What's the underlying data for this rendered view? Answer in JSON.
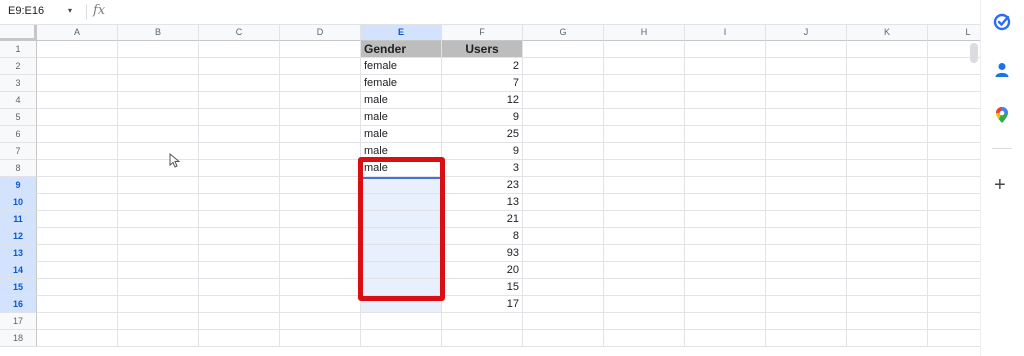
{
  "name_box": {
    "value": "E9:E16",
    "caret": "▾"
  },
  "formula_bar": {
    "fx_label": "fx",
    "value": ""
  },
  "columns": [
    "A",
    "B",
    "C",
    "D",
    "E",
    "F",
    "G",
    "H",
    "I",
    "J",
    "K",
    "L"
  ],
  "selected_column": "E",
  "rows": [
    "1",
    "2",
    "3",
    "4",
    "5",
    "6",
    "7",
    "8",
    "9",
    "10",
    "11",
    "12",
    "13",
    "14",
    "15",
    "16",
    "17",
    "18"
  ],
  "selected_rows": [
    "9",
    "10",
    "11",
    "12",
    "13",
    "14",
    "15",
    "16"
  ],
  "table": {
    "headers": {
      "gender": "Gender",
      "users": "Users"
    },
    "gender": [
      "female",
      "female",
      "male",
      "male",
      "male",
      "male",
      "male",
      "",
      "",
      "",
      "",
      "",
      "",
      "",
      ""
    ],
    "users": [
      "2",
      "7",
      "12",
      "9",
      "25",
      "9",
      "3",
      "23",
      "13",
      "21",
      "8",
      "93",
      "20",
      "15",
      "17"
    ]
  },
  "selection": {
    "range": "E9:E16",
    "highlight_color": "#d90f13"
  },
  "side_panel": {
    "icons": [
      "tasks-icon",
      "contacts-icon",
      "maps-icon"
    ],
    "add_label": "+"
  },
  "colors": {
    "selection_fill": "#e8f0fe",
    "header_fill": "#bdbdbd",
    "accent": "#0b57d0"
  }
}
